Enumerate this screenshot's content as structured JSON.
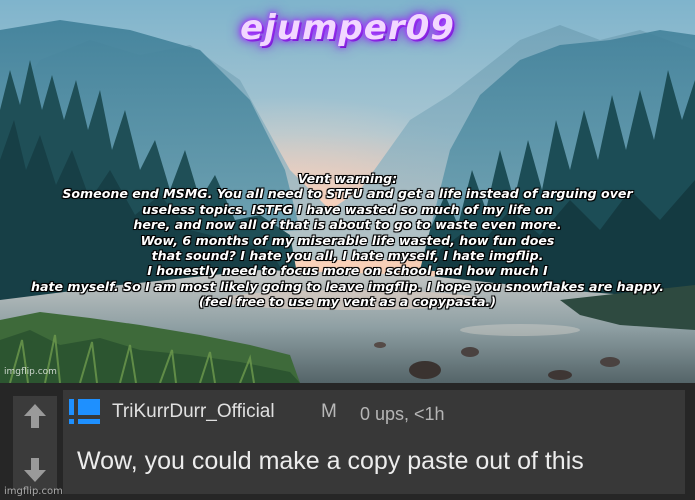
{
  "meme": {
    "title": "ejumper09",
    "vent_lines": [
      "Vent warning:",
      "Someone end MSMG. You all need to STFU and get a life instead of arguing over",
      "useless topics. ISTFG I have wasted so much of my life on",
      "here, and now all of that is about to go to waste even more.",
      "Wow, 6 months of my miserable life wasted, how fun does",
      "that sound? I hate you all, I hate myself, I hate imgflip.",
      "I honestly need to focus more on school and how much I",
      "hate myself. So I am most likely going to leave imgflip. I hope you snowflakes are happy.",
      "(feel free to use my vent as a copypasta.)"
    ],
    "watermark": "imgflip.com",
    "title_color": "#f2d8ff",
    "glow_color": "#9b30ff"
  },
  "comment": {
    "upvote_icon": "arrow-up-icon",
    "downvote_icon": "arrow-down-icon",
    "user_icon": "blue-bar-icon",
    "username": "TriKurrDurr_Official",
    "badge": "M",
    "ups_text": "0 ups, <1h",
    "text": "Wow, you could make a copy paste out of this",
    "user_icon_color": "#1e90ff",
    "watermark": "imgflip.com"
  }
}
